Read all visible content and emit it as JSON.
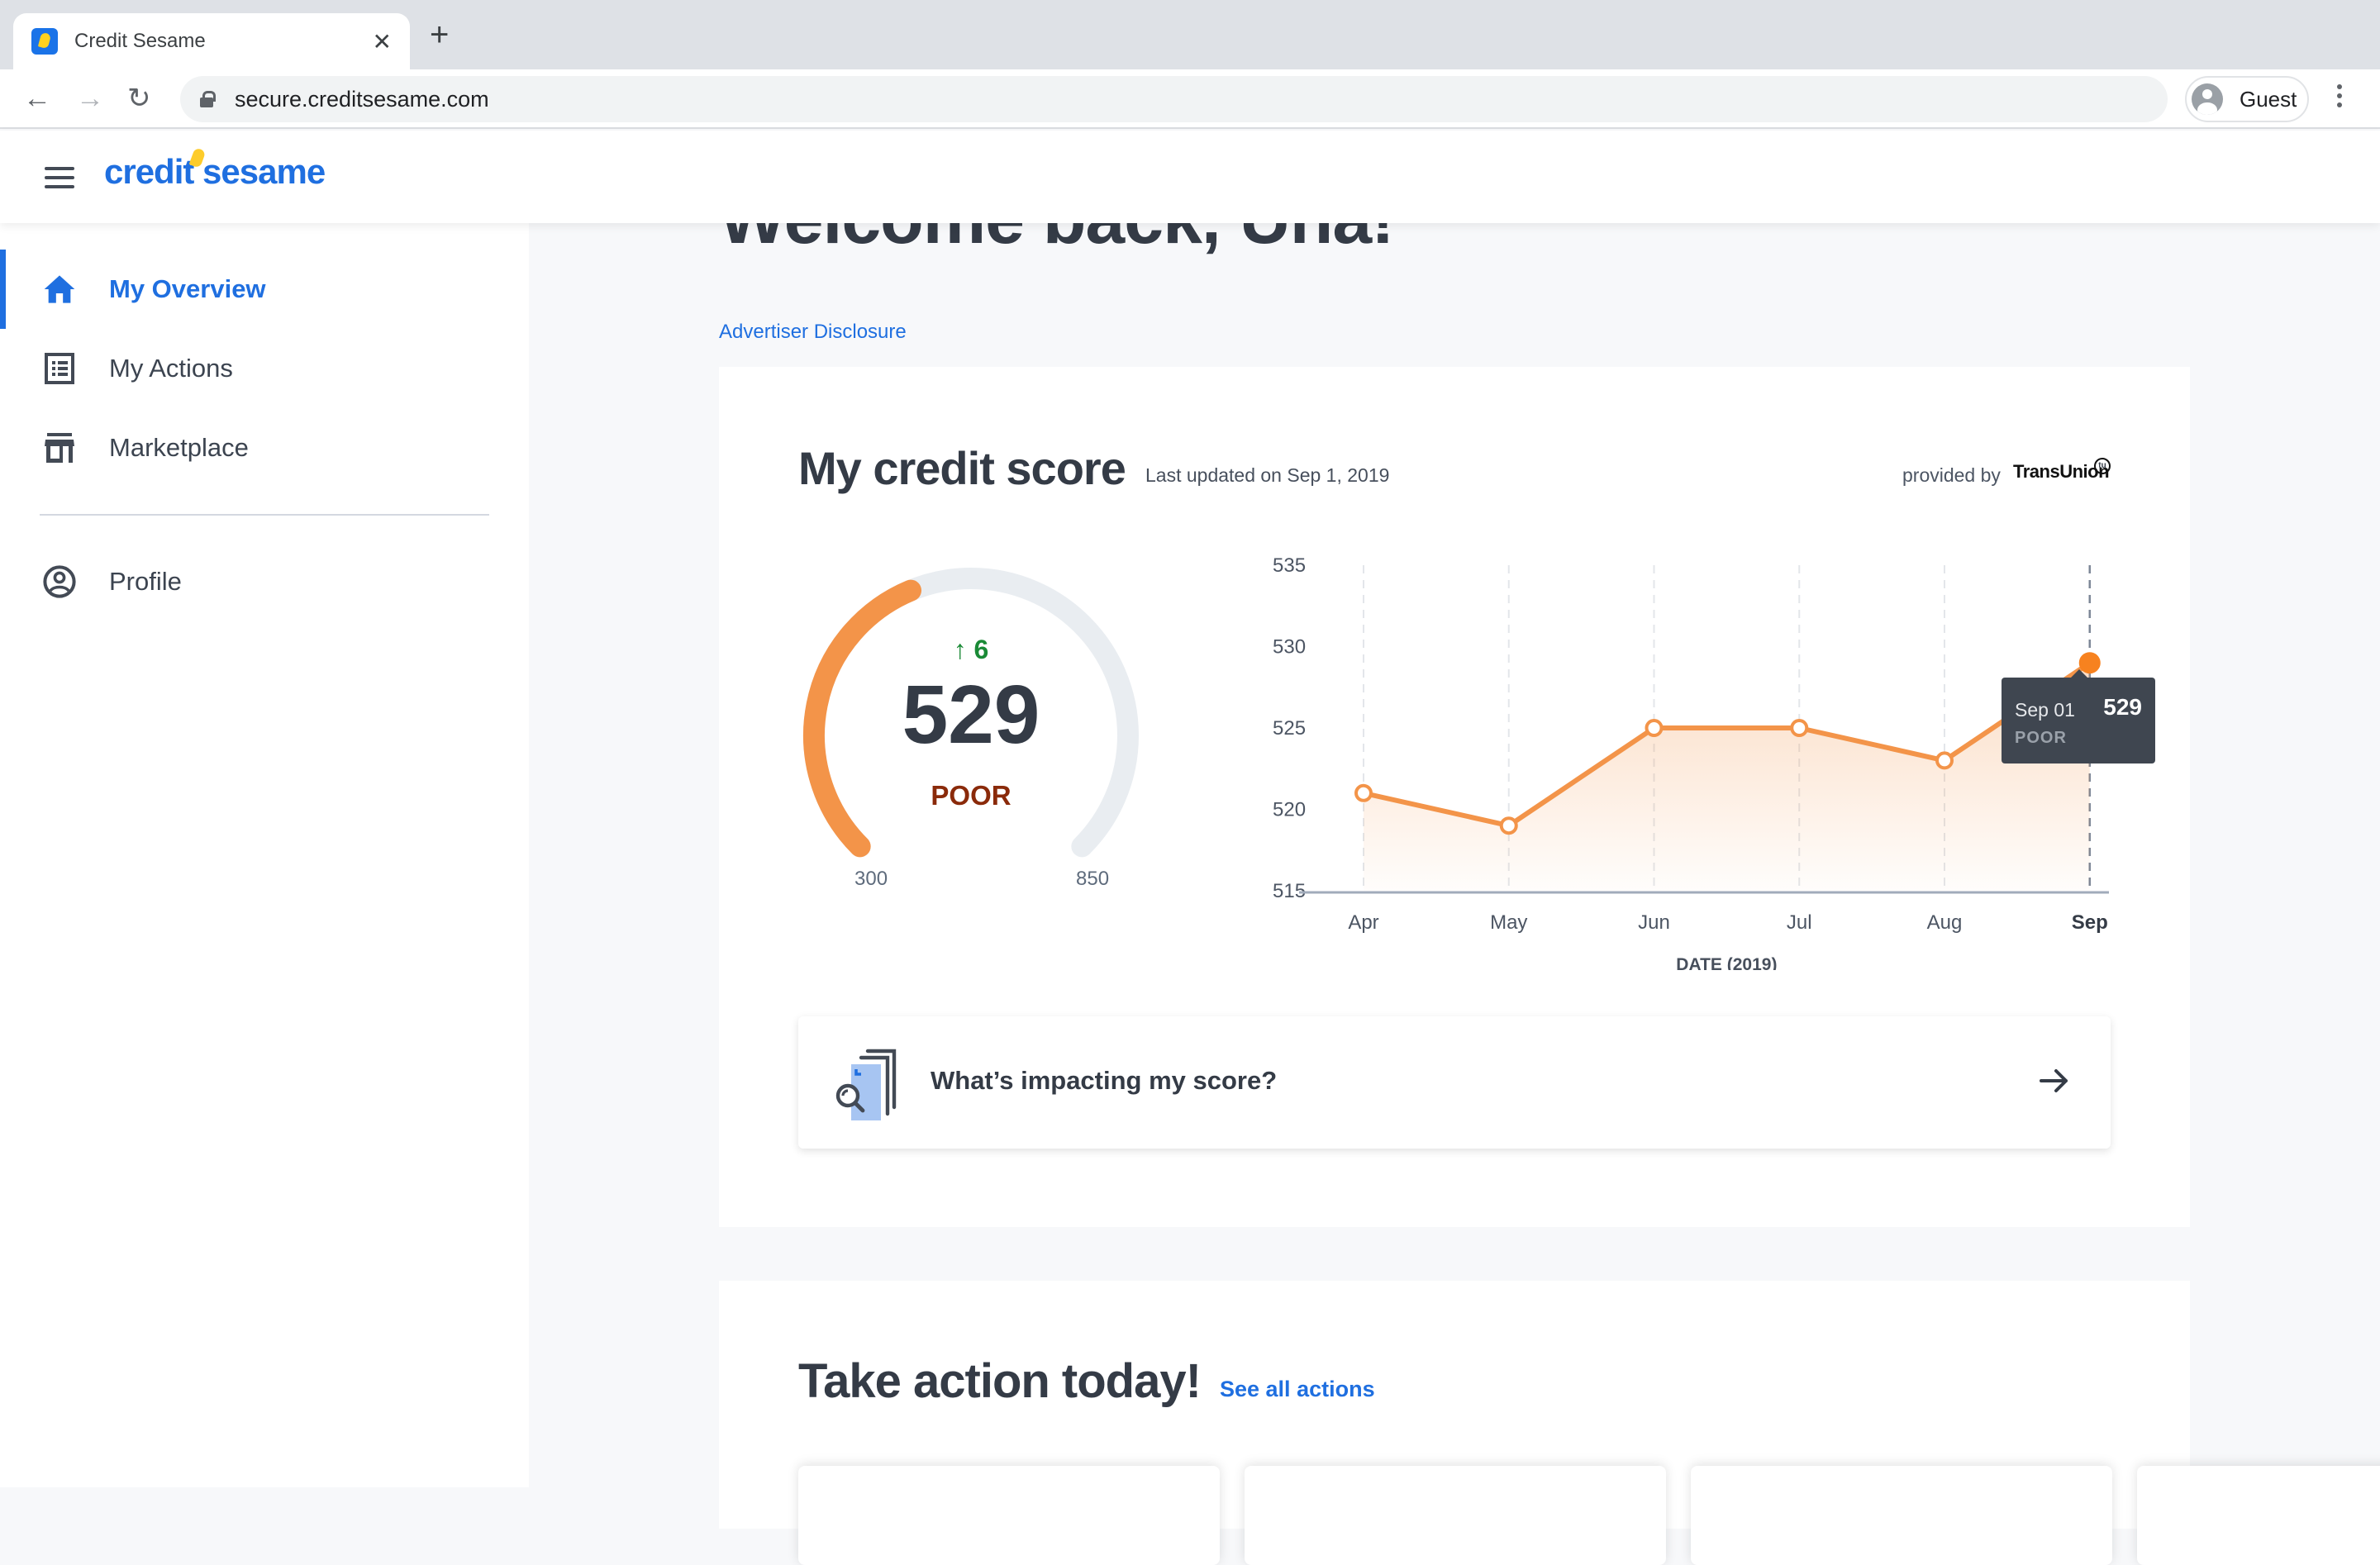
{
  "browser": {
    "tab_title": "Credit Sesame",
    "url": "secure.creditsesame.com",
    "profile_label": "Guest"
  },
  "header": {
    "logo_text": "credit sesame"
  },
  "sidebar": {
    "items": [
      {
        "label": "My Overview",
        "icon": "home-icon",
        "active": true
      },
      {
        "label": "My Actions",
        "icon": "list-icon",
        "active": false
      },
      {
        "label": "Marketplace",
        "icon": "store-icon",
        "active": false
      },
      {
        "label": "Profile",
        "icon": "user-circle-icon",
        "active": false
      }
    ]
  },
  "main": {
    "welcome": "Welcome back, Una!",
    "advertiser_disclosure": "Advertiser Disclosure",
    "credit_score": {
      "title": "My credit score",
      "last_updated": "Last updated on Sep 1, 2019",
      "provided_by": "provided by",
      "provider": "TransUnion",
      "provider_mark": "tu",
      "score": "529",
      "score_value": 529,
      "rating": "POOR",
      "change": "6",
      "change_direction": "up",
      "range_min": "300",
      "range_max": "850",
      "gauge_min_value": 300,
      "gauge_max_value": 850,
      "colors": {
        "score_arc": "#f39449",
        "track": "#e9edf1",
        "delta": "#1a8a36",
        "rating": "#8a2a0a"
      }
    },
    "tooltip": {
      "date": "Sep 01",
      "value": "529",
      "rating": "POOR"
    },
    "impact_card": {
      "label": "What’s impacting my score?"
    },
    "take_action": {
      "title": "Take action today!",
      "see_all": "See all actions"
    }
  },
  "chart_data": {
    "type": "line",
    "title": "",
    "xlabel": "DATE (2019)",
    "ylabel": "",
    "categories": [
      "Apr",
      "May",
      "Jun",
      "Jul",
      "Aug",
      "Sep"
    ],
    "series": [
      {
        "name": "Credit score",
        "values": [
          521,
          519,
          525,
          525,
          523,
          529
        ],
        "color": "#f39449"
      }
    ],
    "yticks": [
      515,
      520,
      525,
      530,
      535
    ],
    "ylim": [
      515,
      535
    ],
    "grid": "vertical-dashed",
    "highlighted_category": "Sep",
    "fill": "gradient-area"
  }
}
